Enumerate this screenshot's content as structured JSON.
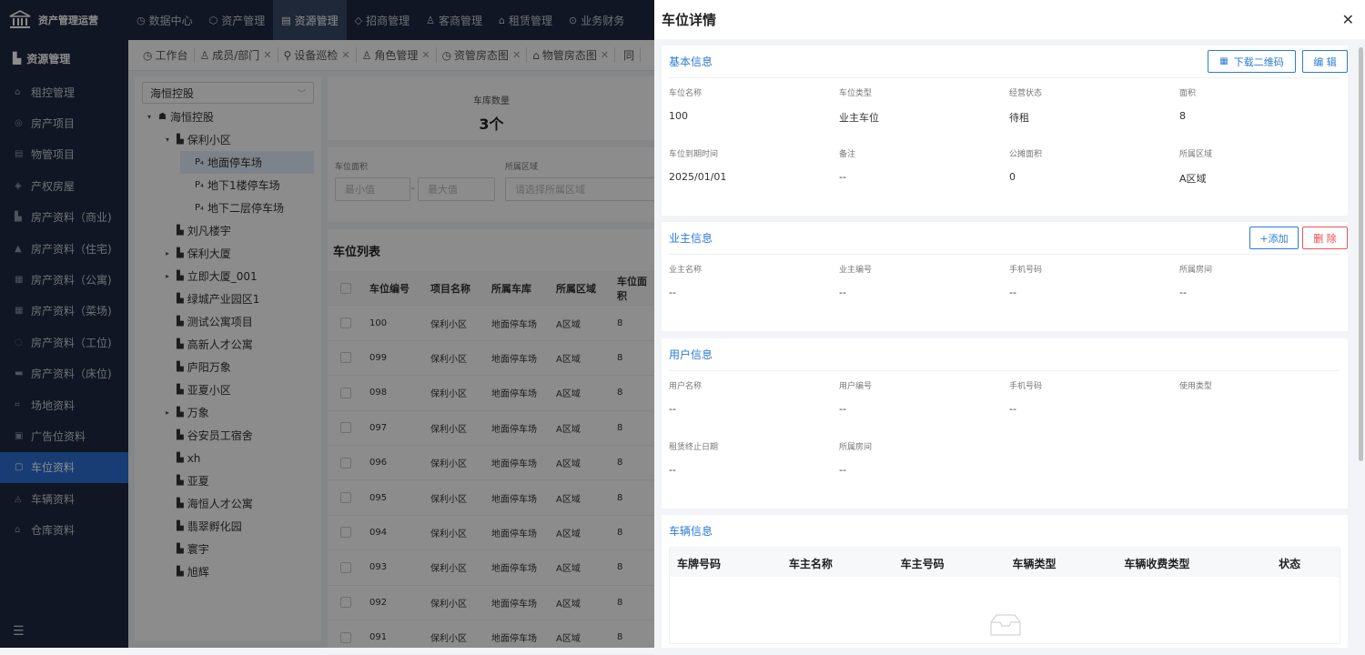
{
  "app": {
    "title": "资产管理运营"
  },
  "nav": [
    {
      "icon": "◷",
      "label": "数据中心"
    },
    {
      "icon": "⬡",
      "label": "资产管理"
    },
    {
      "icon": "▤",
      "label": "资源管理",
      "active": true
    },
    {
      "icon": "◇",
      "label": "招商管理"
    },
    {
      "icon": "♙",
      "label": "客商管理"
    },
    {
      "icon": "⌂",
      "label": "租赁管理"
    },
    {
      "icon": "⊙",
      "label": "业务财务"
    }
  ],
  "sidebar": {
    "header": "资源管理",
    "items": [
      {
        "icon": "⌂",
        "label": "租控管理"
      },
      {
        "icon": "◎",
        "label": "房产项目"
      },
      {
        "icon": "▤",
        "label": "物管项目"
      },
      {
        "icon": "◈",
        "label": "产权房屋"
      },
      {
        "icon": "▙",
        "label": "房产资料（商业)"
      },
      {
        "icon": "▲",
        "label": "房产资料（住宅)"
      },
      {
        "icon": "▦",
        "label": "房产资料（公寓)"
      },
      {
        "icon": "▦",
        "label": "房产资料（菜场)"
      },
      {
        "icon": "◌",
        "label": "房产资料（工位)"
      },
      {
        "icon": "▬",
        "label": "房产资料（床位)"
      },
      {
        "icon": "⌗",
        "label": "场地资料"
      },
      {
        "icon": "▣",
        "label": "广告位资料"
      },
      {
        "icon": "▢",
        "label": "车位资料",
        "active": true
      },
      {
        "icon": "◬",
        "label": "车辆资料"
      },
      {
        "icon": "⌂",
        "label": "仓库资料"
      }
    ],
    "footer": "☰"
  },
  "tabs": [
    {
      "icon": "◷",
      "label": "工作台",
      "close": false
    },
    {
      "icon": "♙",
      "label": "成员/部门",
      "close": true
    },
    {
      "icon": "⚲",
      "label": "设备巡检",
      "close": true
    },
    {
      "icon": "♙",
      "label": "角色管理",
      "close": true
    },
    {
      "icon": "◷",
      "label": "资管房态图",
      "close": true
    },
    {
      "icon": "⌂",
      "label": "物管房态图",
      "close": true
    },
    {
      "icon": "",
      "label": "同",
      "close": false
    }
  ],
  "tree": {
    "select": "海恒控股",
    "nodes": [
      {
        "indent": 0,
        "arrow": "▾",
        "icon": "☗",
        "label": "海恒控股"
      },
      {
        "indent": 1,
        "arrow": "▾",
        "icon": "▙",
        "label": "保利小区"
      },
      {
        "indent": 2,
        "arrow": "",
        "icon": "P₄",
        "label": "地面停车场",
        "selected": true
      },
      {
        "indent": 2,
        "arrow": "",
        "icon": "P₄",
        "label": "地下1楼停车场"
      },
      {
        "indent": 2,
        "arrow": "",
        "icon": "P₄",
        "label": "地下二层停车场"
      },
      {
        "indent": 1,
        "arrow": "",
        "icon": "▙",
        "label": "刘凡楼宇"
      },
      {
        "indent": 1,
        "arrow": "▸",
        "icon": "▙",
        "label": "保利大厦"
      },
      {
        "indent": 1,
        "arrow": "▸",
        "icon": "▙",
        "label": "立即大厦_001"
      },
      {
        "indent": 1,
        "arrow": "",
        "icon": "▙",
        "label": "绿城产业园区1"
      },
      {
        "indent": 1,
        "arrow": "",
        "icon": "▙",
        "label": "测试公寓项目"
      },
      {
        "indent": 1,
        "arrow": "",
        "icon": "▙",
        "label": "高新人才公寓"
      },
      {
        "indent": 1,
        "arrow": "",
        "icon": "▙",
        "label": "庐阳万象"
      },
      {
        "indent": 1,
        "arrow": "",
        "icon": "▙",
        "label": "亚夏小区"
      },
      {
        "indent": 1,
        "arrow": "▸",
        "icon": "▙",
        "label": "万象"
      },
      {
        "indent": 1,
        "arrow": "",
        "icon": "▙",
        "label": "谷安员工宿舍"
      },
      {
        "indent": 1,
        "arrow": "",
        "icon": "▙",
        "label": "xh"
      },
      {
        "indent": 1,
        "arrow": "",
        "icon": "▙",
        "label": "亚夏"
      },
      {
        "indent": 1,
        "arrow": "",
        "icon": "▙",
        "label": "海恒人才公寓"
      },
      {
        "indent": 1,
        "arrow": "",
        "icon": "▙",
        "label": "翡翠孵化园"
      },
      {
        "indent": 1,
        "arrow": "",
        "icon": "▙",
        "label": "寰宇"
      },
      {
        "indent": 1,
        "arrow": "",
        "icon": "▙",
        "label": "旭辉"
      }
    ]
  },
  "stat": {
    "label": "车库数量",
    "value": "3个"
  },
  "filter": {
    "area_label": "车位面积",
    "min_placeholder": "最小值",
    "sep": "-",
    "max_placeholder": "最大值",
    "region_label": "所属区域",
    "region_placeholder": "请选择所属区域"
  },
  "list": {
    "title": "车位列表",
    "columns": [
      "车位编号",
      "项目名称",
      "所属车库",
      "所属区域",
      "车位面积"
    ],
    "rows": [
      [
        "100",
        "保利小区",
        "地面停车场",
        "A区域",
        "8"
      ],
      [
        "099",
        "保利小区",
        "地面停车场",
        "A区域",
        "8"
      ],
      [
        "098",
        "保利小区",
        "地面停车场",
        "A区域",
        "8"
      ],
      [
        "097",
        "保利小区",
        "地面停车场",
        "A区域",
        "8"
      ],
      [
        "096",
        "保利小区",
        "地面停车场",
        "A区域",
        "8"
      ],
      [
        "095",
        "保利小区",
        "地面停车场",
        "A区域",
        "8"
      ],
      [
        "094",
        "保利小区",
        "地面停车场",
        "A区域",
        "8"
      ],
      [
        "093",
        "保利小区",
        "地面停车场",
        "A区域",
        "8"
      ],
      [
        "092",
        "保利小区",
        "地面停车场",
        "A区域",
        "8"
      ],
      [
        "091",
        "保利小区",
        "地面停车场",
        "A区域",
        "8"
      ]
    ]
  },
  "drawer": {
    "title": "车位详情",
    "close": "✕",
    "basic": {
      "title": "基本信息",
      "qr_button": "下载二维码",
      "edit_button": "编 辑",
      "fields": [
        {
          "label": "车位名称",
          "value": "100"
        },
        {
          "label": "车位类型",
          "value": "业主车位"
        },
        {
          "label": "经营状态",
          "value": "待租"
        },
        {
          "label": "面积",
          "value": "8"
        },
        {
          "label": "车位到期时间",
          "value": "2025/01/01"
        },
        {
          "label": "备注",
          "value": "--"
        },
        {
          "label": "公摊面积",
          "value": "0"
        },
        {
          "label": "所属区域",
          "value": "A区域"
        }
      ]
    },
    "owner": {
      "title": "业主信息",
      "add_button": "+添加",
      "delete_button": "删 除",
      "fields": [
        {
          "label": "业主名称",
          "value": "--"
        },
        {
          "label": "业主编号",
          "value": "--"
        },
        {
          "label": "手机号码",
          "value": "--"
        },
        {
          "label": "所属房间",
          "value": "--"
        }
      ]
    },
    "user": {
      "title": "用户信息",
      "fields": [
        {
          "label": "用户名称",
          "value": "--"
        },
        {
          "label": "用户编号",
          "value": "--"
        },
        {
          "label": "手机号码",
          "value": "--"
        },
        {
          "label": "使用类型",
          "value": ""
        },
        {
          "label": "租赁终止日期",
          "value": "--"
        },
        {
          "label": "所属房间",
          "value": "--"
        }
      ]
    },
    "vehicle": {
      "title": "车辆信息",
      "columns": [
        "车牌号码",
        "车主名称",
        "车主号码",
        "车辆类型",
        "车辆收费类型",
        "状态"
      ]
    }
  }
}
